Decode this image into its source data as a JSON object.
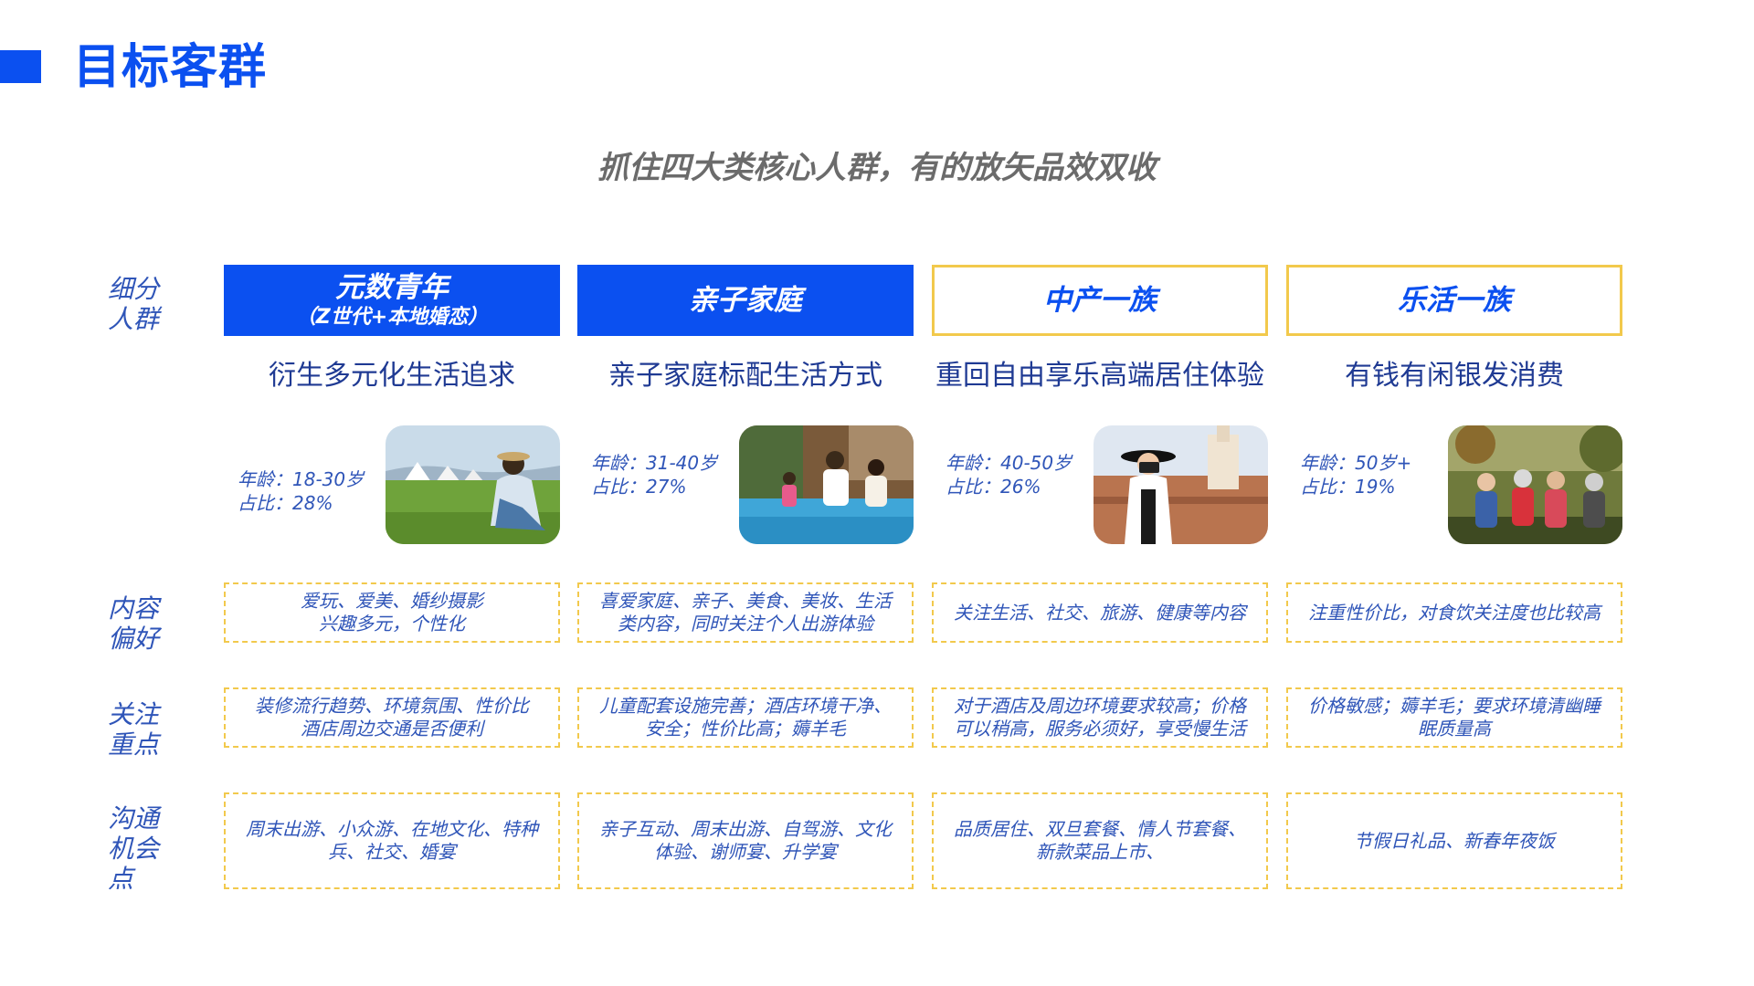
{
  "page": {
    "title": "目标客群",
    "subtitle": "抓住四大类核心人群，有的放矢品效双收"
  },
  "row_labels": {
    "segment": "细分\n人群",
    "content": "内容\n偏好",
    "focus": "关注\n重点",
    "opportunity": "沟通\n机会\n点"
  },
  "colors": {
    "accent": "#0b50f0",
    "highlight_border": "#f2c94c",
    "text": "#1f3a93",
    "subtitle": "#6b6b6b"
  },
  "segments": [
    {
      "name": "元数青年",
      "sub": "（Z世代+本地婚恋）",
      "style": "blue",
      "tagline": "衍生多元化生活追求",
      "age": "年龄：18-30岁",
      "share": "占比：28%",
      "photo": "young-woman-on-grass-photo",
      "content": "爱玩、爱美、婚纱摄影\n兴趣多元，个性化",
      "focus": "装修流行趋势、环境氛围、性价比\n酒店周边交通是否便利",
      "opportunity": "周末出游、小众游、在地文化、特种\n兵、社交、婚宴"
    },
    {
      "name": "亲子家庭",
      "sub": "",
      "style": "blue",
      "tagline": "亲子家庭标配生活方式",
      "age": "年龄：31-40岁",
      "share": "占比：27%",
      "photo": "family-by-pool-photo",
      "content": "喜爱家庭、亲子、美食、美妆、生活\n类内容，同时关注个人出游体验",
      "focus": "儿童配套设施完善；酒店环境干净、\n安全；性价比高；薅羊毛",
      "opportunity": "亲子互动、周末出游、自驾游、文化\n体验、谢师宴、升学宴"
    },
    {
      "name": "中产一族",
      "sub": "",
      "style": "gold",
      "tagline": "重回自由享乐高端居住体验",
      "age": "年龄：40-50岁",
      "share": "占比：26%",
      "photo": "woman-with-camera-photo",
      "content": "关注生活、社交、旅游、健康等内容",
      "focus": "对于酒店及周边环境要求较高；价格\n可以稍高，服务必须好，享受慢生活",
      "opportunity": "品质居住、双旦套餐、情人节套餐、\n新款菜品上市、"
    },
    {
      "name": "乐活一族",
      "sub": "",
      "style": "gold",
      "tagline": "有钱有闲银发消费",
      "age": "年龄：50岁+",
      "share": "占比：19%",
      "photo": "seniors-hiking-photo",
      "content": "注重性价比，对食饮关注度也比较高",
      "focus": "价格敏感；薅羊毛；要求环境清幽睡\n眠质量高",
      "opportunity": "节假日礼品、新春年夜饭"
    }
  ]
}
